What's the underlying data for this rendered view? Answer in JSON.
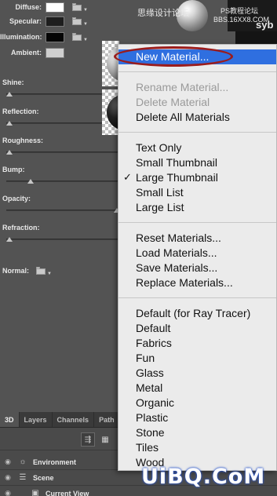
{
  "material_props": {
    "color_rows": [
      {
        "label": "Diffuse:",
        "color": "#ffffff"
      },
      {
        "label": "Specular:",
        "color": "#1e1e1e"
      },
      {
        "label": "Illumination:",
        "color": "#050505"
      },
      {
        "label": "Ambient:",
        "color": "#cfcfcf"
      }
    ],
    "sliders": [
      {
        "label": "Shine:",
        "value": 0.0
      },
      {
        "label": "Reflection:",
        "value": 0.0
      },
      {
        "label": "Roughness:",
        "value": 0.0
      },
      {
        "label": "Bump:",
        "value": 0.2
      },
      {
        "label": "Opacity:",
        "value": 1.0
      },
      {
        "label": "Refraction:",
        "value": 0.0
      }
    ],
    "normal_label": "Normal:"
  },
  "watermarks": {
    "top_cn": "思缘设计论坛",
    "top_ps": "PS教程论坛",
    "top_bbs": "BBS.16XX8.COM",
    "top_partial": "syb",
    "brand": "UiBQ.CoM"
  },
  "menu": {
    "groups": [
      [
        {
          "label": "New Material...",
          "state": "highlighted"
        }
      ],
      [
        {
          "label": "Rename Material...",
          "state": "disabled"
        },
        {
          "label": "Delete Material",
          "state": "disabled"
        },
        {
          "label": "Delete All Materials",
          "state": "enabled"
        }
      ],
      [
        {
          "label": "Text Only",
          "state": "enabled"
        },
        {
          "label": "Small Thumbnail",
          "state": "enabled"
        },
        {
          "label": "Large Thumbnail",
          "state": "checked"
        },
        {
          "label": "Small List",
          "state": "enabled"
        },
        {
          "label": "Large List",
          "state": "enabled"
        }
      ],
      [
        {
          "label": "Reset Materials...",
          "state": "enabled"
        },
        {
          "label": "Load Materials...",
          "state": "enabled"
        },
        {
          "label": "Save Materials...",
          "state": "enabled"
        },
        {
          "label": "Replace Materials...",
          "state": "enabled"
        }
      ],
      [
        {
          "label": "Default (for Ray Tracer)",
          "state": "enabled"
        },
        {
          "label": "Default",
          "state": "enabled"
        },
        {
          "label": "Fabrics",
          "state": "enabled"
        },
        {
          "label": "Fun",
          "state": "enabled"
        },
        {
          "label": "Glass",
          "state": "enabled"
        },
        {
          "label": "Metal",
          "state": "enabled"
        },
        {
          "label": "Organic",
          "state": "enabled"
        },
        {
          "label": "Plastic",
          "state": "enabled"
        },
        {
          "label": "Stone",
          "state": "enabled"
        },
        {
          "label": "Tiles",
          "state": "enabled"
        },
        {
          "label": "Wood",
          "state": "enabled"
        }
      ]
    ],
    "check_glyph": "✓"
  },
  "bottom_panel": {
    "tabs": [
      "3D",
      "Layers",
      "Channels",
      "Path"
    ],
    "active_tab": 0,
    "layers": [
      {
        "name": "Environment",
        "icon": "environment-icon",
        "glyph": "☼",
        "indent": 0
      },
      {
        "name": "Scene",
        "icon": "scene-icon",
        "glyph": "☰",
        "indent": 0
      },
      {
        "name": "Current View",
        "icon": "camera-icon",
        "glyph": "▣",
        "indent": 1
      }
    ]
  }
}
